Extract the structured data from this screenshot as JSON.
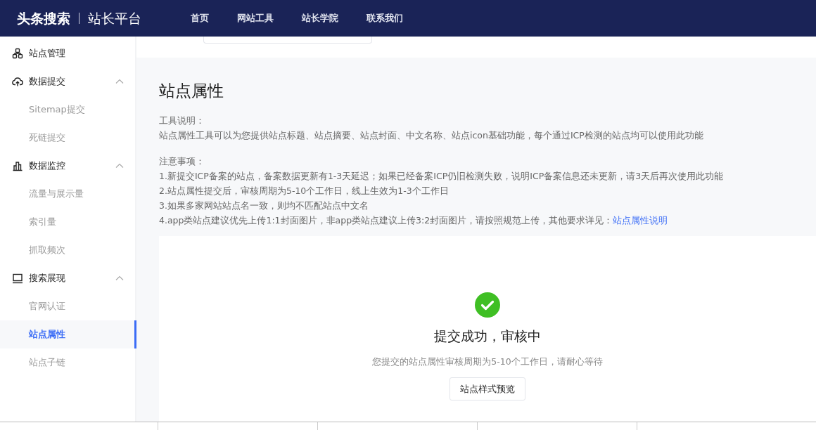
{
  "header": {
    "logo": "头条搜索",
    "product": "站长平台",
    "nav": [
      {
        "label": "首页"
      },
      {
        "label": "网站工具"
      },
      {
        "label": "站长学院"
      },
      {
        "label": "联系我们"
      }
    ]
  },
  "sidebar": {
    "groups": [
      {
        "kind": "link",
        "label": "站点管理"
      },
      {
        "kind": "group",
        "label": "数据提交",
        "expanded": true,
        "children": [
          {
            "label": "Sitemap提交",
            "selected": false
          },
          {
            "label": "死链提交",
            "selected": false
          }
        ]
      },
      {
        "kind": "group",
        "label": "数据监控",
        "expanded": true,
        "children": [
          {
            "label": "流量与展示量",
            "selected": false
          },
          {
            "label": "索引量",
            "selected": false
          },
          {
            "label": "抓取频次",
            "selected": false
          }
        ]
      },
      {
        "kind": "group",
        "label": "搜索展现",
        "expanded": true,
        "children": [
          {
            "label": "官网认证",
            "selected": false
          },
          {
            "label": "站点属性",
            "selected": true
          },
          {
            "label": "站点子链",
            "selected": false
          }
        ]
      }
    ]
  },
  "page": {
    "title": "站点属性",
    "tool_description": {
      "heading": "工具说明：",
      "text": "站点属性工具可以为您提供站点标题、站点摘要、站点封面、中文名称、站点icon基础功能，每个通过ICP检测的站点均可以使用此功能"
    },
    "notes": {
      "heading": "注意事项：",
      "items": [
        {
          "text": "1.新提交ICP备案的站点，备案数据更新有1-3天延迟；如果已经备案ICP仍旧检测失败，说明ICP备案信息还未更新，请3天后再次使用此功能"
        },
        {
          "text": "2.站点属性提交后，审核周期为5-10个工作日，线上生效为1-3个工作日"
        },
        {
          "text": "3.如果多家网站站点名一致，则均不匹配站点中文名"
        },
        {
          "text": "4.app类站点建议优先上传1:1封面图片，非app类站点建议上传3:2封面图片，请按照规范上传，其他要求详见：",
          "link": "站点属性说明"
        }
      ]
    }
  },
  "result": {
    "title": "提交成功，审核中",
    "message": "您提交的站点属性审核周期为5-10个工作日，请耐心等待",
    "button": "站点样式预览"
  }
}
